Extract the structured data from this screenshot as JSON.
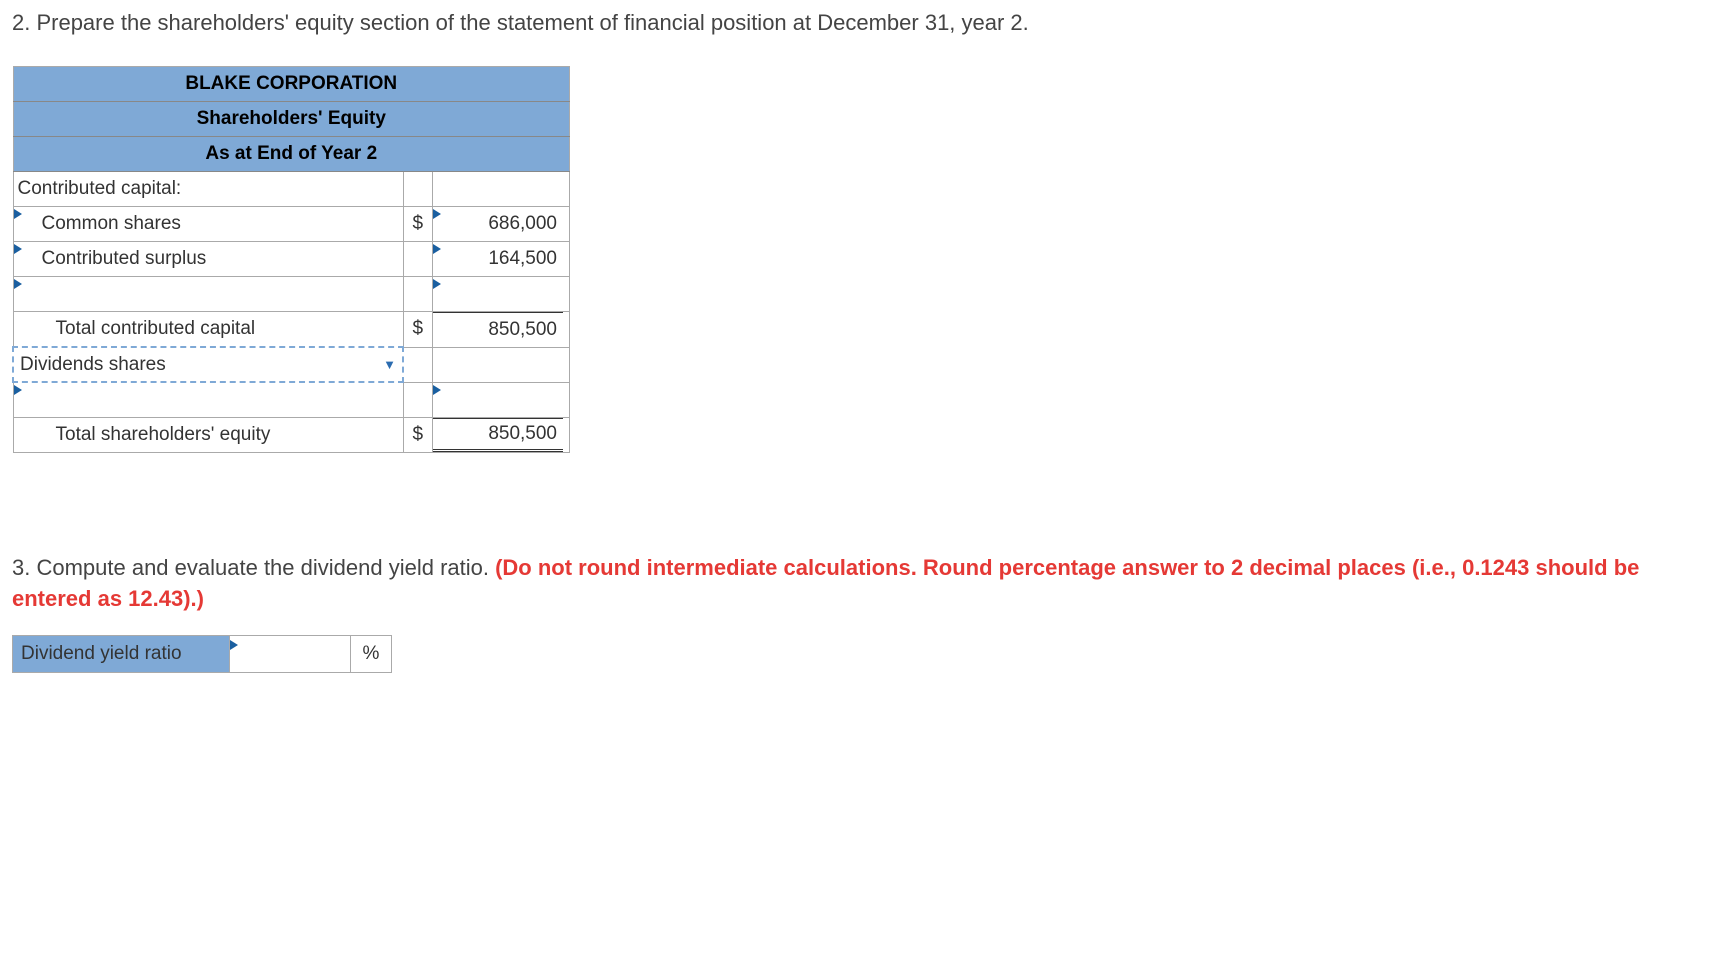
{
  "q2": {
    "prompt": "2. Prepare the shareholders' equity section of the statement of financial position at December 31, year 2.",
    "header1": "BLAKE CORPORATION",
    "header2": "Shareholders' Equity",
    "header3": "As at End of Year 2",
    "rows": {
      "contributed_capital_label": "Contributed capital:",
      "common_shares_label": "Common shares",
      "common_shares_currency": "$",
      "common_shares_value": "686,000",
      "contributed_surplus_label": "Contributed surplus",
      "contributed_surplus_value": "164,500",
      "blank_row_label": "",
      "blank_row_value": "",
      "total_contributed_label": "Total contributed capital",
      "total_contributed_currency": "$",
      "total_contributed_value": "850,500",
      "dropdown_selected": "Dividends shares",
      "empty_row_value": "",
      "total_equity_label": "Total shareholders' equity",
      "total_equity_currency": "$",
      "total_equity_value": "850,500"
    }
  },
  "q3": {
    "prompt_main": "3. Compute and evaluate the dividend yield ratio. ",
    "prompt_hint": "(Do not round intermediate calculations. Round percentage answer to 2 decimal places (i.e., 0.1243 should be entered as 12.43).)",
    "row_label": "Dividend yield ratio",
    "value": "",
    "unit": "%"
  }
}
